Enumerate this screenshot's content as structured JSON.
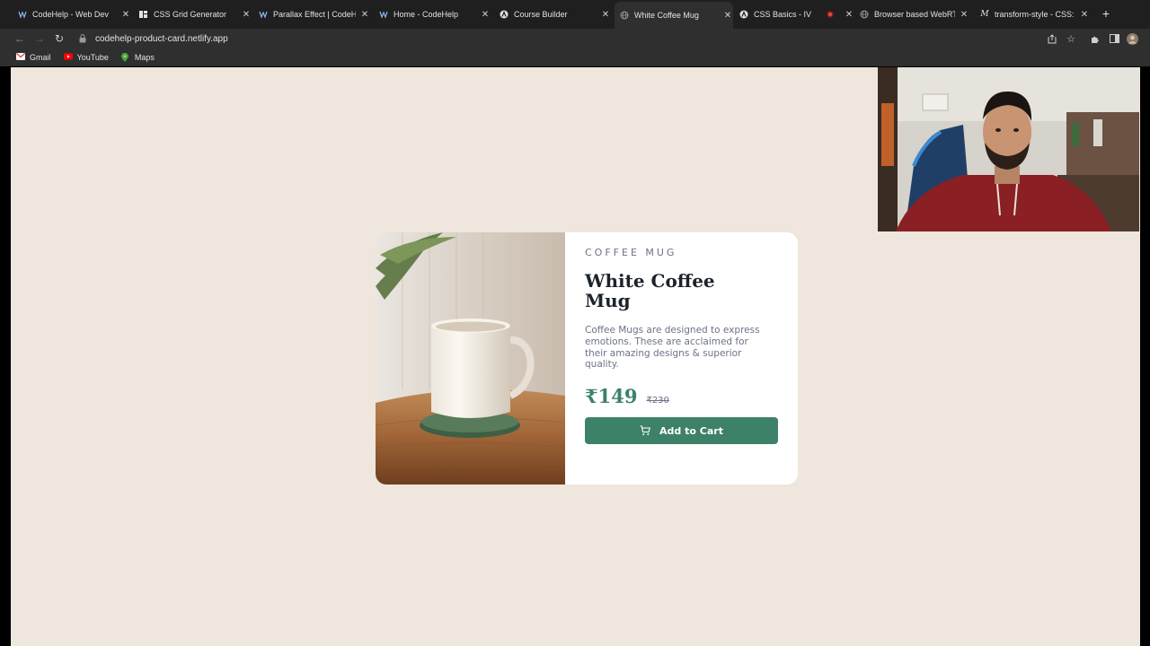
{
  "browser": {
    "tabs": [
      {
        "title": "CodeHelp - Web Dev",
        "icon": "codehelp-icon"
      },
      {
        "title": "CSS Grid Generator",
        "icon": "grid-icon"
      },
      {
        "title": "Parallax Effect | CodeHe",
        "icon": "codehelp-icon"
      },
      {
        "title": "Home - CodeHelp",
        "icon": "codehelp-icon"
      },
      {
        "title": "Course Builder",
        "icon": "a-icon"
      },
      {
        "title": "White Coffee Mug",
        "icon": "globe-icon"
      },
      {
        "title": "CSS Basics - IV",
        "icon": "a-icon"
      },
      {
        "title": "",
        "icon": "record-icon"
      },
      {
        "title": "Browser based WebRTC",
        "icon": "globe-icon"
      },
      {
        "title": "transform-style - CSS:",
        "icon": "m-icon"
      }
    ],
    "active_tab_index": 5,
    "address": "codehelp-product-card.netlify.app",
    "bookmarks": [
      {
        "label": "Gmail",
        "icon": "gmail-icon"
      },
      {
        "label": "YouTube",
        "icon": "youtube-icon"
      },
      {
        "label": "Maps",
        "icon": "maps-icon"
      }
    ]
  },
  "product": {
    "category": "COFFEE MUG",
    "name": "White Coffee Mug",
    "description": "Coffee Mugs are designed to express emotions. These are acclaimed for their amazing designs & superior quality.",
    "price": "₹149",
    "original_price": "₹230",
    "button_label": "Add to Cart"
  },
  "colors": {
    "page_background": "#efe6dd",
    "accent": "#3d8168",
    "text_dark": "#1c232b",
    "text_muted": "#6c7289"
  }
}
